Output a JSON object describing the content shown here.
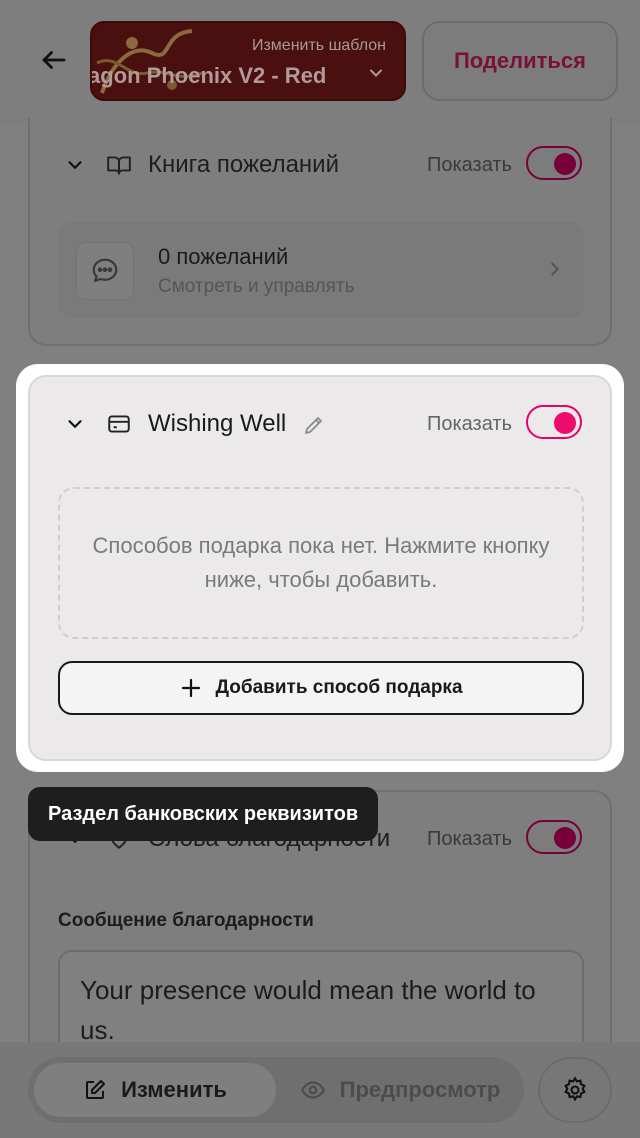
{
  "header": {
    "template_hint": "Изменить шаблон",
    "template_name": "agon Phoenix V2 - Red",
    "share_label": "Поделиться"
  },
  "wishbook": {
    "title": "Книга пожеланий",
    "show_label": "Показать",
    "count_label": "0 пожеланий",
    "sub_label": "Смотреть и управлять"
  },
  "wishing_well": {
    "title": "Wishing Well",
    "show_label": "Показать",
    "empty_text": "Способов подарка пока нет. Нажмите кнопку ниже, чтобы добавить.",
    "add_label": "Добавить способ подарка"
  },
  "tooltip": {
    "text": "Раздел банковских реквизитов"
  },
  "thanks": {
    "title": "Слова благодарности",
    "show_label": "Показать",
    "message_label": "Сообщение благодарности",
    "message_value": "Your presence would mean the world to us."
  },
  "bottom_bar": {
    "edit_label": "Изменить",
    "preview_label": "Предпросмотр"
  },
  "colors": {
    "accent": "#ef0a6e",
    "overlay": "#808080",
    "tooltip_bg": "#1e1e1e"
  }
}
